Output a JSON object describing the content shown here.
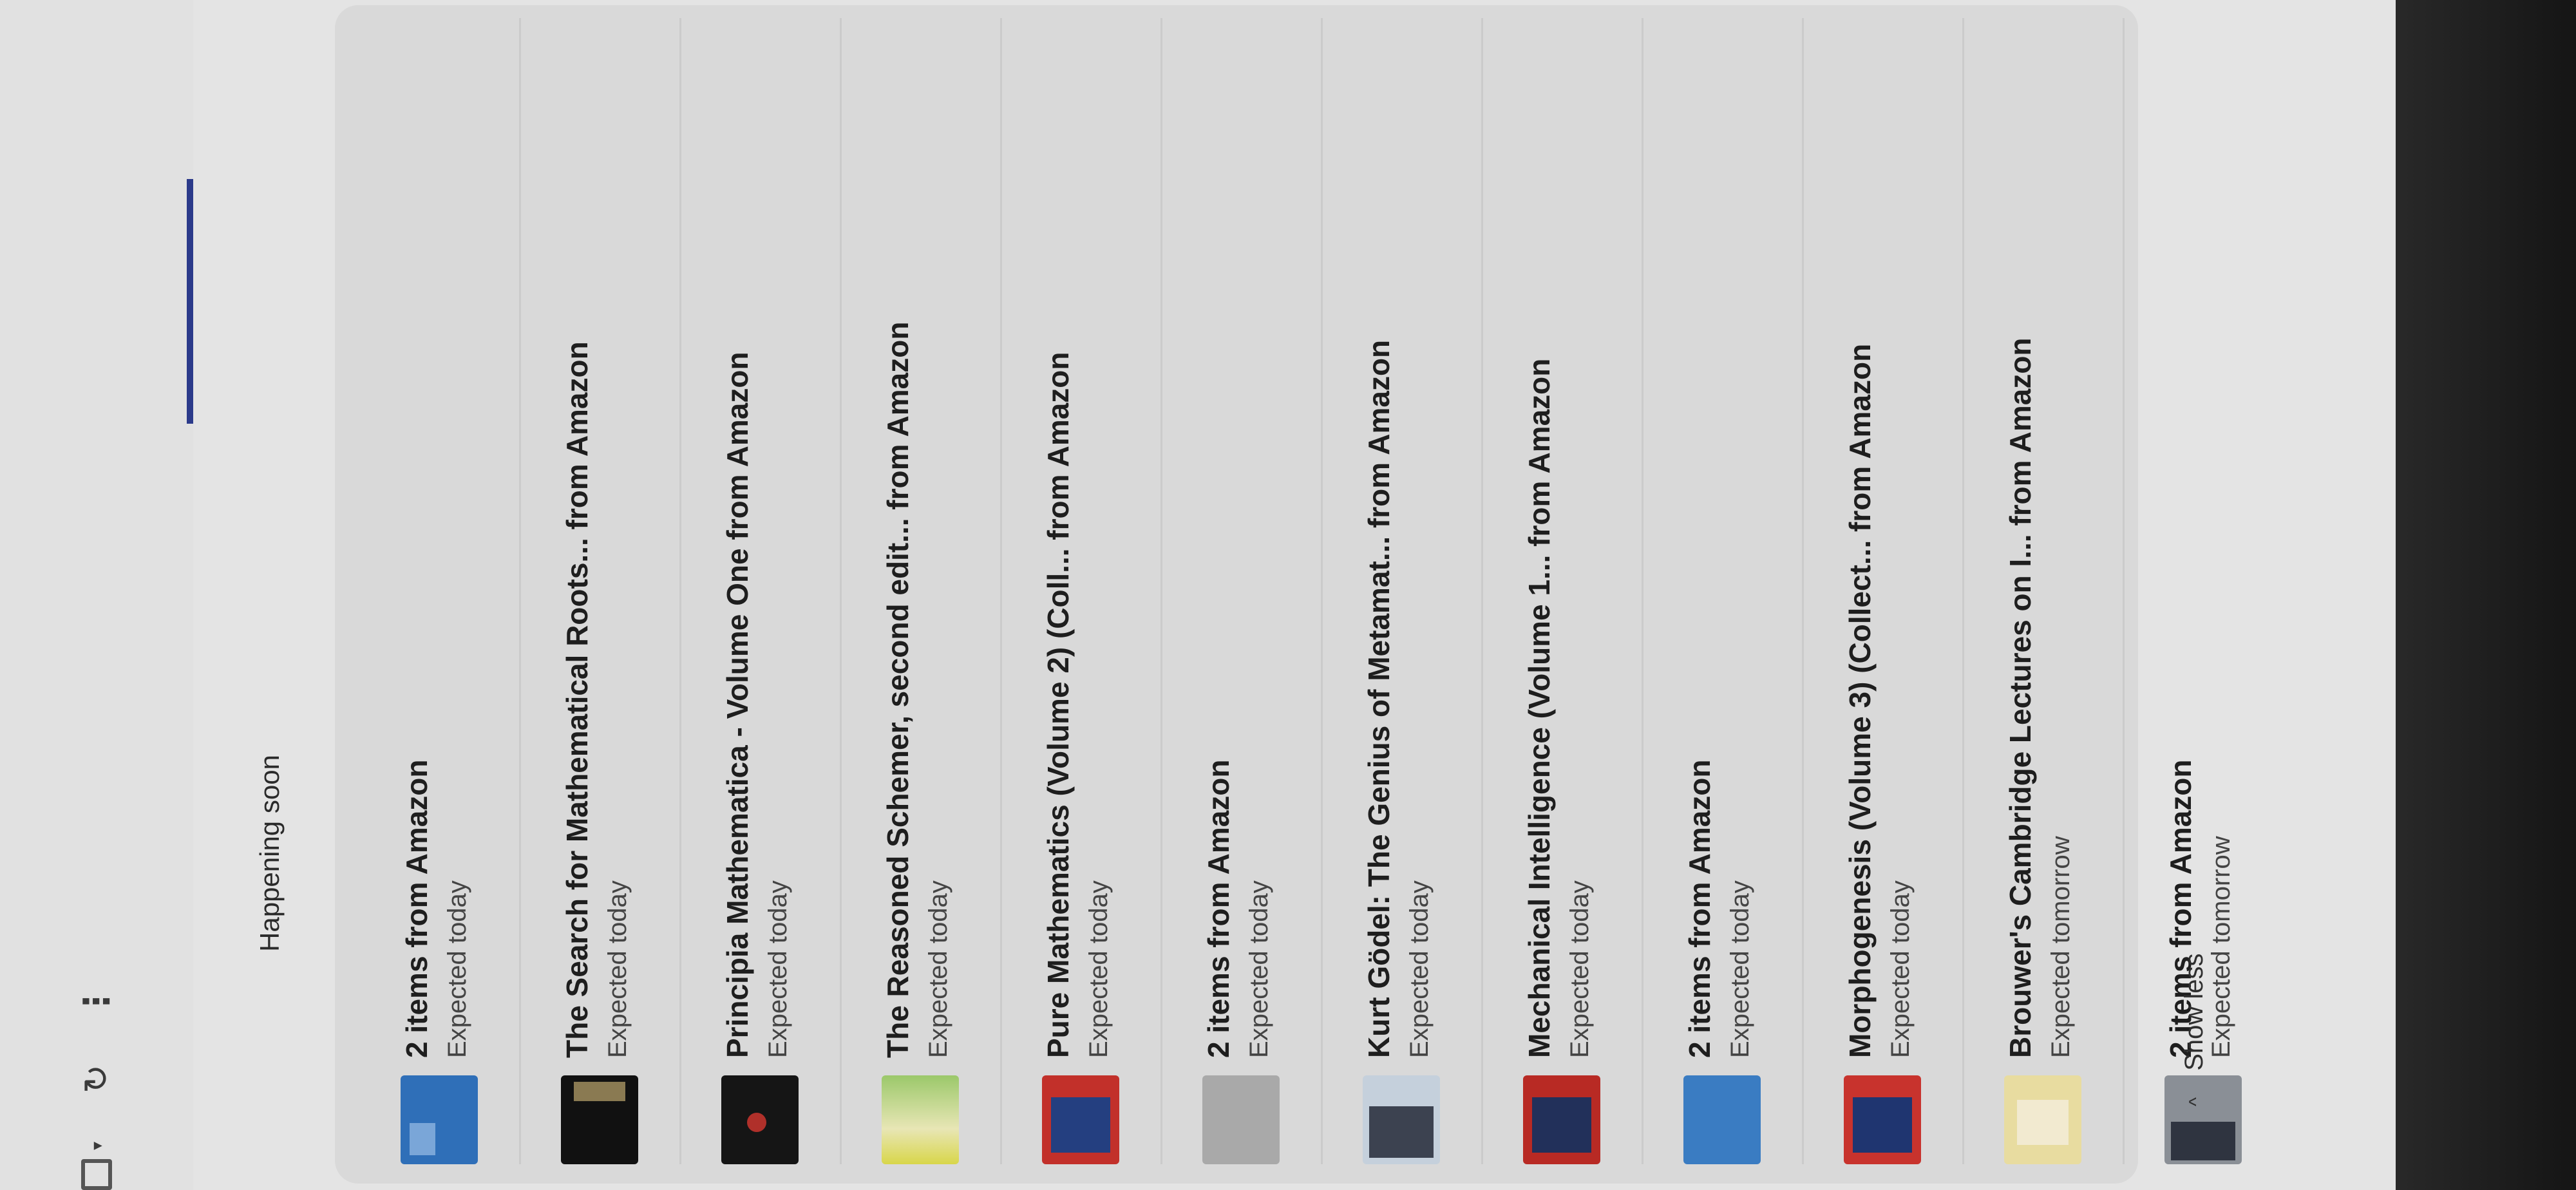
{
  "toolbar": {
    "checkbox_icon": "checkbox-icon",
    "caret_glyph": "▾",
    "refresh_glyph": "↻",
    "more_glyph": "⋮"
  },
  "section": {
    "title": "Happening soon"
  },
  "items": [
    {
      "title": "2 items from Amazon",
      "status": "Expected today",
      "thumb": "c-blue"
    },
    {
      "title": "The Search for Mathematical Roots... from Amazon",
      "status": "Expected today",
      "thumb": "c-black"
    },
    {
      "title": "Principia Mathematica - Volume One from Amazon",
      "status": "Expected today",
      "thumb": "c-black2"
    },
    {
      "title": "The Reasoned Schemer, second edit... from Amazon",
      "status": "Expected today",
      "thumb": "c-green"
    },
    {
      "title": "Pure Mathematics (Volume 2) (Coll... from Amazon",
      "status": "Expected today",
      "thumb": "c-red"
    },
    {
      "title": "2 items from Amazon",
      "status": "Expected today",
      "thumb": "c-grey"
    },
    {
      "title": "Kurt Gödel: The Genius of Metamat... from Amazon",
      "status": "Expected today",
      "thumb": "c-godel"
    },
    {
      "title": "Mechanical Intelligence (Volume 1... from Amazon",
      "status": "Expected today",
      "thumb": "c-red2"
    },
    {
      "title": "2 items from Amazon",
      "status": "Expected today",
      "thumb": "c-blue2"
    },
    {
      "title": "Morphogenesis (Volume 3) (Collect... from Amazon",
      "status": "Expected today",
      "thumb": "c-red3"
    },
    {
      "title": "Brouwer's Cambridge Lectures on I... from Amazon",
      "status": "Expected tomorrow",
      "thumb": "c-cream"
    },
    {
      "title": "2 items from Amazon",
      "status": "Expected tomorrow",
      "thumb": "c-multi"
    }
  ],
  "show_less": {
    "label": "Show less",
    "chevron": "^"
  }
}
